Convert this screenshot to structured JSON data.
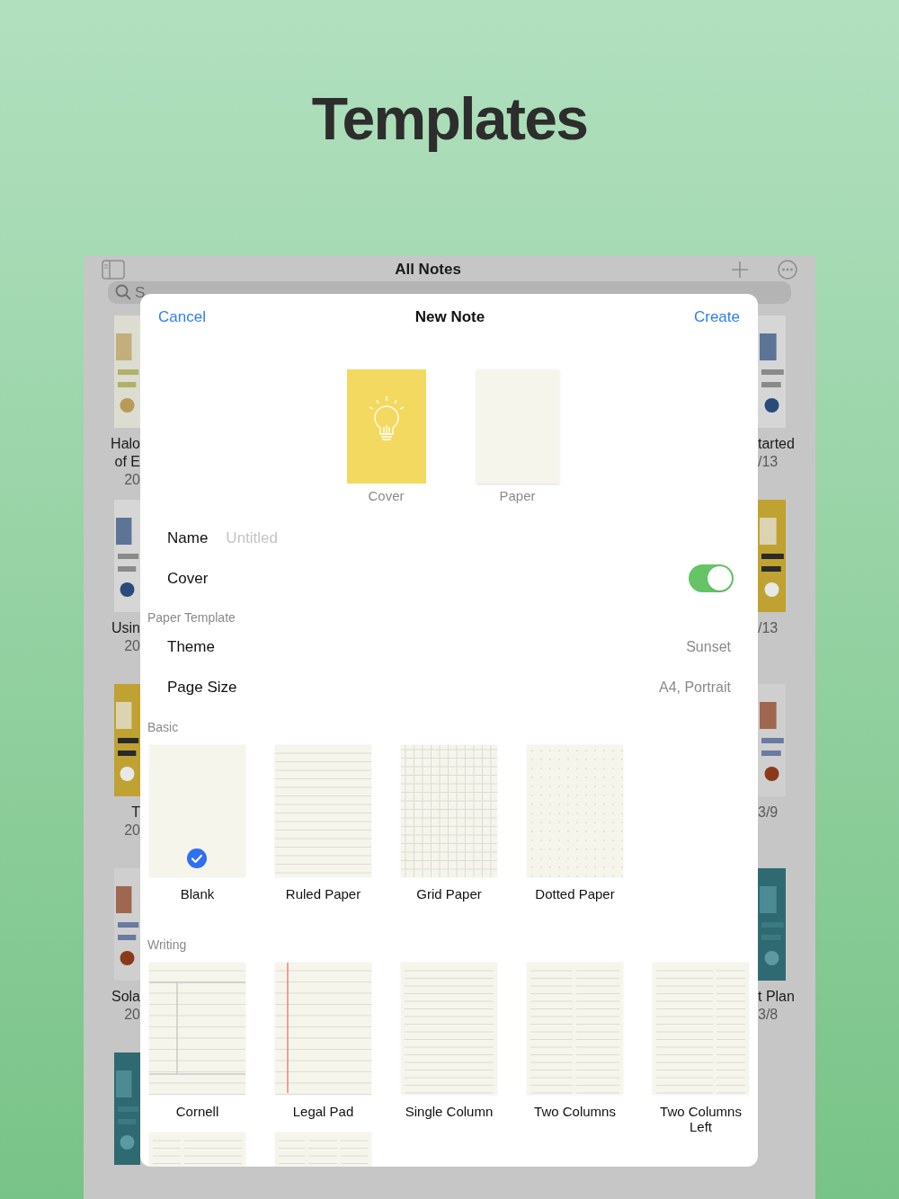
{
  "headline": "Templates",
  "screen": {
    "nav_title": "All Notes",
    "search": {
      "placeholder": "S"
    },
    "left_notes": [
      {
        "kind": "picture",
        "lines": [
          "Halo",
          "of E"
        ],
        "date": "20"
      },
      {
        "kind": "picture",
        "lines": [
          "Usin"
        ],
        "date": "20"
      },
      {
        "kind": "picture",
        "lines": [
          "T"
        ],
        "date": "20"
      },
      {
        "kind": "picture",
        "lines": [
          "Sola"
        ],
        "date": "20"
      },
      {
        "kind": "picture"
      }
    ],
    "right_notes": [
      {
        "kind": "picture",
        "lines": [
          "tarted"
        ],
        "date": "/13"
      },
      {
        "kind": "picture",
        "date": "/13"
      },
      {
        "kind": "picture",
        "date": "3/9"
      },
      {
        "kind": "picture",
        "lines": [
          "t Plan"
        ],
        "date": "3/8"
      }
    ]
  },
  "sheet": {
    "cancel": "Cancel",
    "title": "New Note",
    "create": "Create",
    "previews": [
      {
        "kind": "cover",
        "label": "Cover"
      },
      {
        "kind": "paper",
        "label": "Paper"
      }
    ],
    "name": {
      "label": "Name",
      "placeholder": "Untitled"
    },
    "cover": {
      "label": "Cover",
      "on": true
    },
    "paper_template": {
      "header": "Paper Template",
      "rows": [
        {
          "label": "Theme",
          "value": "Sunset"
        },
        {
          "label": "Page Size",
          "value": "A4, Portrait"
        }
      ]
    },
    "sections": [
      {
        "header": "Basic",
        "templates": [
          {
            "kind": "blank",
            "label": "Blank",
            "selected": true
          },
          {
            "kind": "ruled",
            "label": "Ruled Paper",
            "selected": false
          },
          {
            "kind": "grid",
            "label": "Grid Paper",
            "selected": false
          },
          {
            "kind": "dotted",
            "label": "Dotted Paper",
            "selected": false
          }
        ]
      },
      {
        "header": "Writing",
        "templates": [
          {
            "kind": "cornell",
            "label": "Cornell",
            "selected": false
          },
          {
            "kind": "legal",
            "label": "Legal Pad",
            "selected": false
          },
          {
            "kind": "single",
            "label": "Single Column",
            "selected": false
          },
          {
            "kind": "two",
            "label": "Two Columns",
            "selected": false
          },
          {
            "kind": "twoleft",
            "label": "Two Columns Left",
            "selected": false
          }
        ]
      }
    ],
    "more_templates": [
      {
        "kind": "tworight",
        "selected": false
      },
      {
        "kind": "three",
        "selected": false
      }
    ]
  }
}
